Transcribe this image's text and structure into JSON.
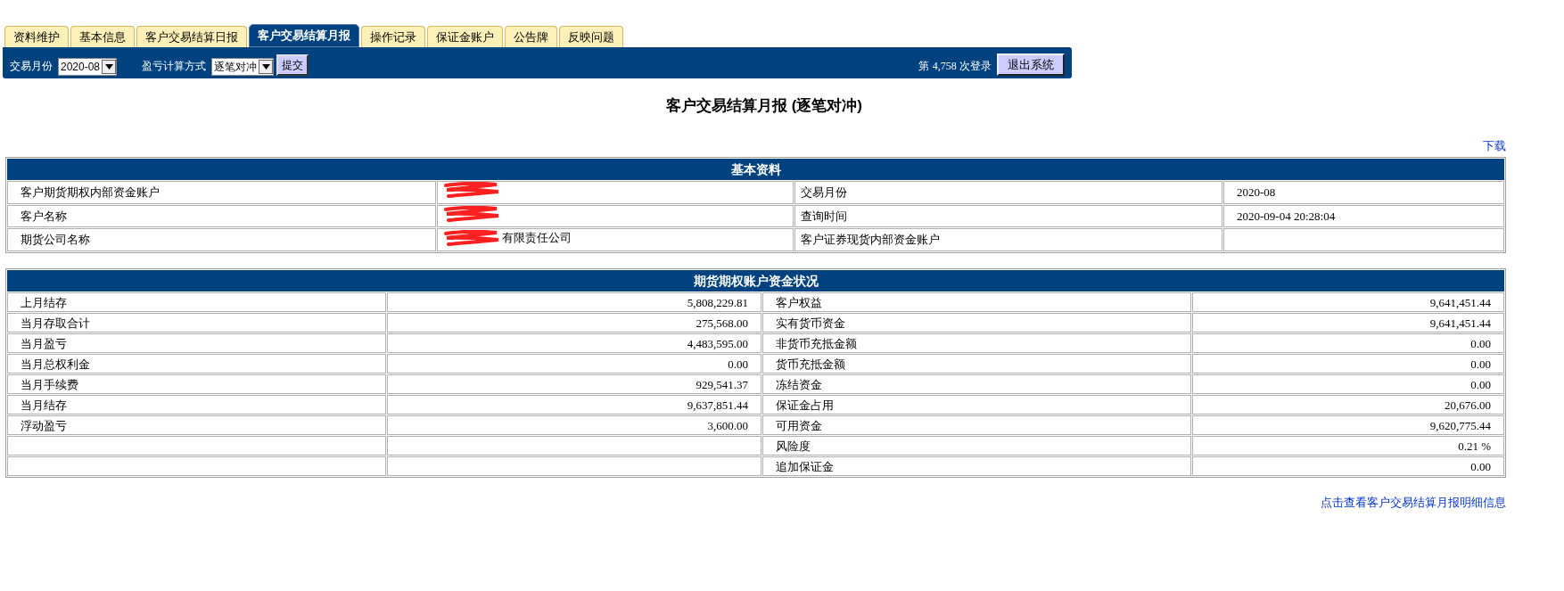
{
  "tabs": [
    {
      "label": "资料维护",
      "selected": false
    },
    {
      "label": "基本信息",
      "selected": false
    },
    {
      "label": "客户交易结算日报",
      "selected": false
    },
    {
      "label": "客户交易结算月报",
      "selected": true
    },
    {
      "label": "操作记录",
      "selected": false
    },
    {
      "label": "保证金账户",
      "selected": false
    },
    {
      "label": "公告牌",
      "selected": false
    },
    {
      "label": "反映问题",
      "selected": false
    }
  ],
  "toolbar": {
    "month_label": "交易月份",
    "month_value": "2020-08",
    "method_label": "盈亏计算方式",
    "method_value": "逐笔对冲",
    "submit": "提交",
    "login_prefix": "第",
    "login_count": "4,758",
    "login_suffix": "次登录",
    "logout": "退出系统"
  },
  "report_title": "客户交易结算月报 (逐笔对冲)",
  "download_link": "下载",
  "basic_info": {
    "title": "基本资料",
    "rows": [
      {
        "cells": [
          {
            "text": "客户期货期权内部资金账户"
          },
          {
            "redacted": true
          },
          {
            "text": "交易月份"
          },
          {
            "text": "2020-08"
          }
        ]
      },
      {
        "cells": [
          {
            "text": "客户名称"
          },
          {
            "redacted": true
          },
          {
            "text": "查询时间"
          },
          {
            "text": "2020-09-04 20:28:04"
          }
        ]
      },
      {
        "cells": [
          {
            "text": "期货公司名称"
          },
          {
            "text": "有限责任公司",
            "redacted": true
          },
          {
            "text": "客户证券现货内部资金账户"
          },
          {}
        ]
      }
    ]
  },
  "funds": {
    "title": "期货期权账户资金状况",
    "rows": [
      {
        "cells": [
          "上月结存",
          "5,808,229.81",
          "客户权益",
          "9,641,451.44"
        ]
      },
      {
        "cells": [
          "当月存取合计",
          "275,568.00",
          "实有货币资金",
          "9,641,451.44"
        ]
      },
      {
        "cells": [
          "当月盈亏",
          "4,483,595.00",
          "非货币充抵金额",
          "0.00"
        ]
      },
      {
        "cells": [
          "当月总权利金",
          "0.00",
          "货币充抵金额",
          "0.00"
        ]
      },
      {
        "cells": [
          "当月手续费",
          "929,541.37",
          "冻结资金",
          "0.00"
        ]
      },
      {
        "cells": [
          "当月结存",
          "9,637,851.44",
          "保证金占用",
          "20,676.00"
        ]
      },
      {
        "cells": [
          "浮动盈亏",
          "3,600.00",
          "可用资金",
          "9,620,775.44"
        ]
      },
      {
        "cells": [
          null,
          null,
          "风险度",
          "0.21 %"
        ]
      },
      {
        "cells": [
          null,
          null,
          "追加保证金",
          "0.00"
        ]
      }
    ]
  },
  "detail_link": "点击查看客户交易结算月报明细信息"
}
